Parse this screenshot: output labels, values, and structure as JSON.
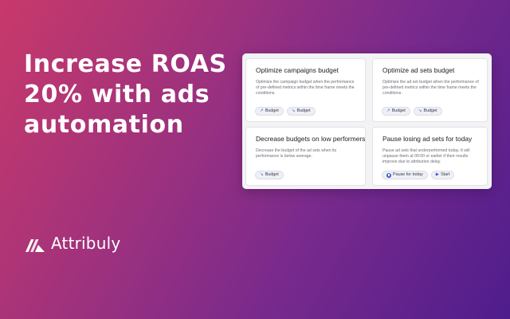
{
  "hero": {
    "headline_lines": [
      "Increase ROAS",
      "20% with ads",
      "automation"
    ]
  },
  "brand": {
    "name": "Attribuly",
    "logo_icon": "attribuly-logo-icon"
  },
  "colors": {
    "background_start": "#c8396a",
    "background_end": "#4f1d8c",
    "panel": "#f3f3f6",
    "accent": "#3b5bd1"
  },
  "cards": [
    {
      "title": "Optimize campaigns budget",
      "description": "Optimize the campaign budget when the performance of pre-defined metrics within the time frame meets the conditions.",
      "tags": [
        {
          "icon": "arrow-up-right-icon",
          "glyph": "↗",
          "label": "Budget"
        },
        {
          "icon": "arrow-down-right-icon",
          "glyph": "↘",
          "label": "Budget"
        }
      ]
    },
    {
      "title": "Optimize ad sets budget",
      "description": "Optimize the ad set budget when the performance of pre-defined metrics within the time frame meets the conditions.",
      "tags": [
        {
          "icon": "arrow-up-right-icon",
          "glyph": "↗",
          "label": "Budget"
        },
        {
          "icon": "arrow-down-right-icon",
          "glyph": "↘",
          "label": "Budget"
        }
      ]
    },
    {
      "title": "Decrease budgets on low performers",
      "description": "Decrease the budget of the ad sets when its performance is below average.",
      "tags": [
        {
          "icon": "arrow-down-right-icon",
          "glyph": "↘",
          "label": "Budget"
        }
      ]
    },
    {
      "title": "Pause losing ad sets for today",
      "description": "Pause ad sets that underperformed today. It will unpause them at 00:00 or earlier if their results improve due to attribution delay.",
      "tags": [
        {
          "icon": "pause-icon",
          "glyph": "",
          "label": "Pause for today"
        },
        {
          "icon": "play-icon",
          "glyph": "▶",
          "label": "Start"
        }
      ]
    }
  ]
}
